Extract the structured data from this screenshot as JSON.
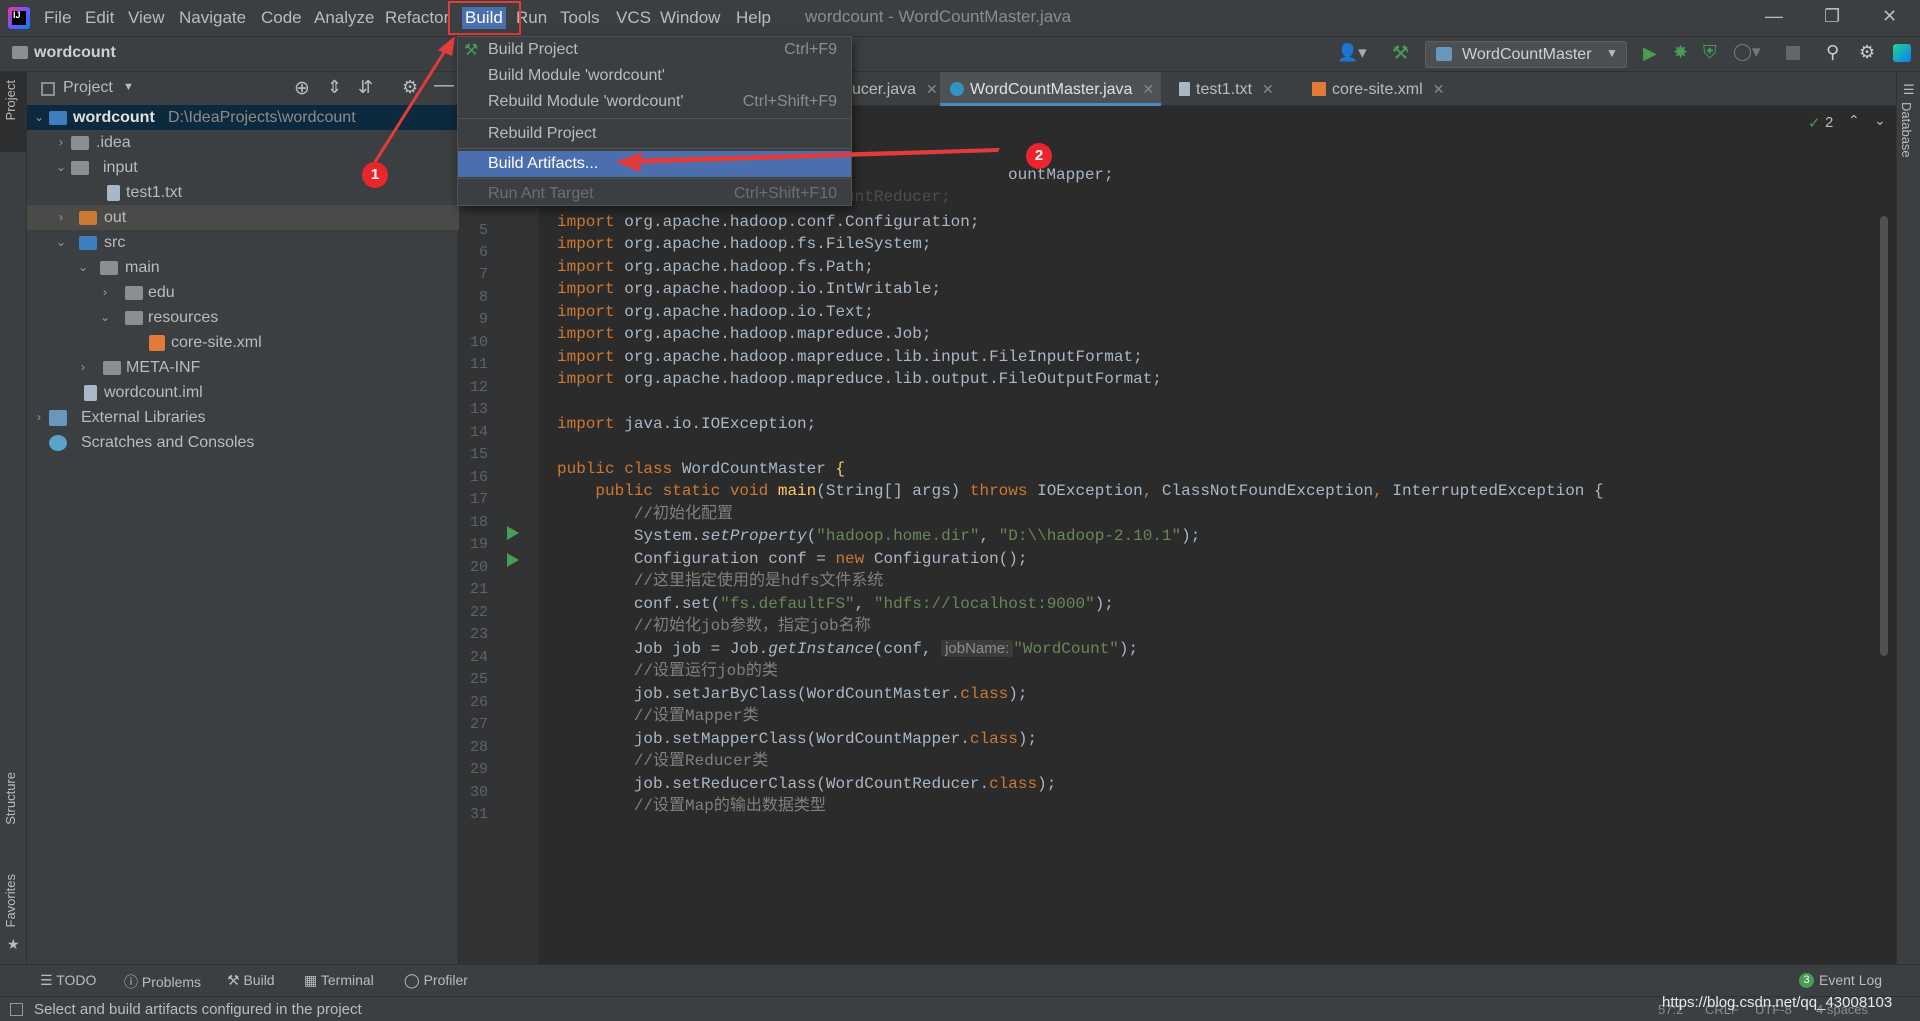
{
  "window_title": "wordcount - WordCountMaster.java",
  "menu": [
    "File",
    "Edit",
    "View",
    "Navigate",
    "Code",
    "Analyze",
    "Refactor",
    "Build",
    "Run",
    "Tools",
    "VCS",
    "Window",
    "Help"
  ],
  "nav": {
    "project": "wordcount",
    "run_config": "WordCountMaster"
  },
  "build_menu": {
    "items": [
      {
        "label": "Build Project",
        "shortcut": "Ctrl+F9"
      },
      {
        "label": "Build Module 'wordcount'",
        "shortcut": ""
      },
      {
        "label": "Rebuild Module 'wordcount'",
        "shortcut": "Ctrl+Shift+F9"
      },
      {
        "label": "Rebuild Project",
        "shortcut": ""
      },
      {
        "label": "Build Artifacts...",
        "shortcut": ""
      },
      {
        "label": "Run Ant Target",
        "shortcut": "Ctrl+Shift+F10"
      }
    ]
  },
  "annotations": {
    "badge1": "1",
    "badge2": "2"
  },
  "project_panel": {
    "title": "Project",
    "tree": [
      {
        "label": "wordcount",
        "path": "D:\\IdeaProjects\\wordcount"
      },
      {
        "label": ".idea"
      },
      {
        "label": "input"
      },
      {
        "label": "test1.txt"
      },
      {
        "label": "out"
      },
      {
        "label": "src"
      },
      {
        "label": "main"
      },
      {
        "label": "edu"
      },
      {
        "label": "resources"
      },
      {
        "label": "core-site.xml"
      },
      {
        "label": "META-INF"
      },
      {
        "label": "wordcount.iml"
      },
      {
        "label": "External Libraries"
      },
      {
        "label": "Scratches and Consoles"
      }
    ]
  },
  "editor_tabs": [
    "ucer.java",
    "WordCountMaster.java",
    "test1.txt",
    "core-site.xml"
  ],
  "inspection_count": "2",
  "code": {
    "line_numbers": [
      "5",
      "6",
      "7",
      "8",
      "9",
      "10",
      "11",
      "12",
      "13",
      "14",
      "15",
      "16",
      "17",
      "18",
      "19",
      "20",
      "21",
      "22",
      "23",
      "24",
      "25",
      "26",
      "27",
      "28",
      "29",
      "30",
      "31"
    ],
    "l3_tail": "ountMapper;",
    "l4_tail": "import main.edu.reducer.WordCountReducer;",
    "imports": [
      "org.apache.hadoop.conf.Configuration;",
      "org.apache.hadoop.fs.FileSystem;",
      "org.apache.hadoop.fs.Path;",
      "org.apache.hadoop.io.IntWritable;",
      "org.apache.hadoop.io.Text;",
      "org.apache.hadoop.mapreduce.Job;",
      "org.apache.hadoop.mapreduce.lib.input.FileInputFormat;",
      "org.apache.hadoop.mapreduce.lib.output.FileOutputFormat;"
    ],
    "import_io": "java.io.IOException;",
    "class_name": "WordCountMaster",
    "comments": [
      "//初始化配置",
      "//这里指定使用的是hdfs文件系统",
      "//初始化job参数，指定job名称",
      "//设置运行job的类",
      "//设置Mapper类",
      "//设置Reducer类",
      "//设置Map的输出数据类型"
    ],
    "str_home_key": "\"hadoop.home.dir\"",
    "str_home_val": "\"D:\\\\hadoop-2.10.1\"",
    "str_fs_key": "\"fs.defaultFS\"",
    "str_fs_val": "\"hdfs://localhost:9000\"",
    "hint_jobname": "jobName:",
    "str_jobname": "\"WordCount\""
  },
  "bottom_tools": [
    "TODO",
    "Problems",
    "Build",
    "Terminal",
    "Profiler",
    "Event Log"
  ],
  "event_log_count": "3",
  "side_tabs": {
    "project": "Project",
    "structure": "Structure",
    "favorites": "Favorites",
    "database": "Database"
  },
  "status": {
    "message": "Select and build artifacts configured in the project",
    "position": "57:2",
    "line_sep": "CRLF",
    "encoding": "UTF-8",
    "indent": "4 spaces",
    "watermark": "https://blog.csdn.net/qq_43008103"
  }
}
